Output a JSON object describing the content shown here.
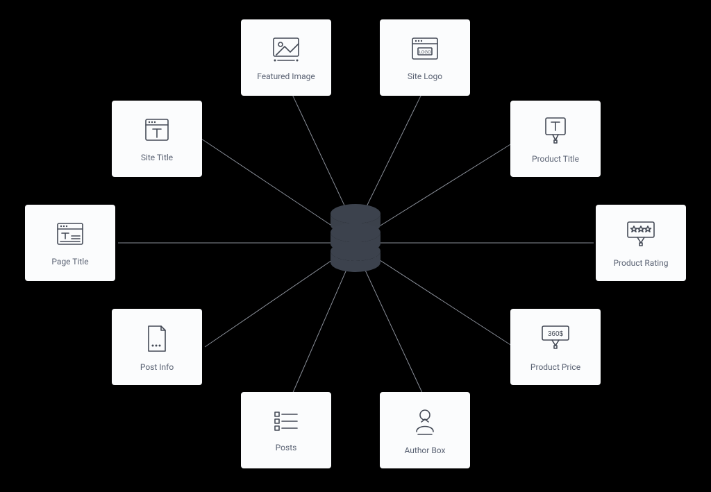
{
  "center": {
    "name": "database-icon"
  },
  "cards": {
    "featured_image": {
      "label": "Featured Image"
    },
    "site_logo": {
      "label": "Site Logo"
    },
    "site_title": {
      "label": "Site Title"
    },
    "product_title": {
      "label": "Product Title"
    },
    "page_title": {
      "label": "Page Title"
    },
    "product_rating": {
      "label": "Product Rating"
    },
    "post_info": {
      "label": "Post Info"
    },
    "product_price": {
      "label": "Product Price",
      "price_text": "360$"
    },
    "posts": {
      "label": "Posts"
    },
    "author_box": {
      "label": "Author Box"
    }
  }
}
